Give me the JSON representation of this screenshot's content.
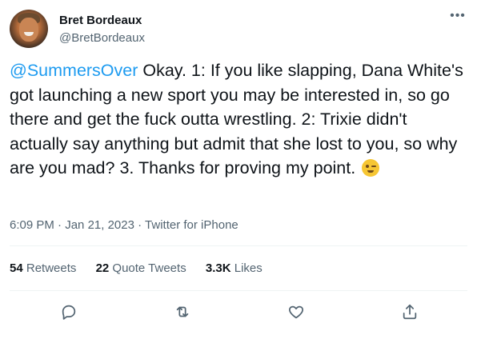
{
  "user": {
    "display_name": "Bret Bordeaux",
    "handle": "@BretBordeaux"
  },
  "tweet": {
    "mention": "@SummersOver",
    "text": " Okay. 1: If you like slapping, Dana White's got launching a new sport you may be interested in, so go there and get the fuck outta wrestling. 2: Trixie didn't actually say anything but admit that she lost to you, so why are you mad? 3. Thanks for proving my point. ",
    "emoji": "winking-face",
    "time": "6:09 PM",
    "separator": " · ",
    "date": "Jan 21, 2023",
    "source": "Twitter for iPhone"
  },
  "stats": {
    "retweets_count": "54",
    "retweets_label": " Retweets",
    "quotes_count": "22",
    "quotes_label": " Quote Tweets",
    "likes_count": "3.3K",
    "likes_label": " Likes"
  },
  "actions": {
    "reply_icon": "reply-icon",
    "retweet_icon": "retweet-icon",
    "like_icon": "heart-icon",
    "share_icon": "share-icon"
  },
  "colors": {
    "accent": "#1d9bf0",
    "text": "#0f1419",
    "muted": "#536471"
  }
}
